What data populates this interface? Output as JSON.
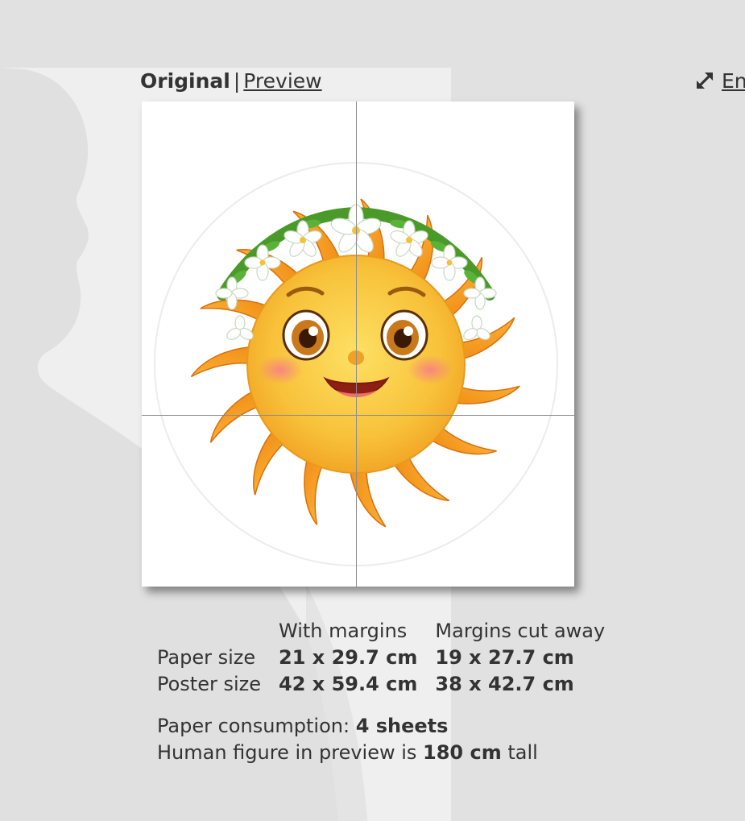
{
  "tabs": {
    "original_label": "Original",
    "separator": "|",
    "preview_label": "Preview"
  },
  "enlarge": {
    "label": "En",
    "icon": "expand-arrows-icon"
  },
  "poster": {
    "image": "smiling sun with flower crown",
    "sheets_horizontal": 2,
    "sheets_vertical": 2
  },
  "table": {
    "col_with_margins": "With margins",
    "col_margins_cut": "Margins cut away",
    "rows": [
      {
        "label": "Paper size",
        "with_margins": "21 x 29.7 cm",
        "cut_away": "19 x 27.7 cm"
      },
      {
        "label": "Poster size",
        "with_margins": "42 x 59.4 cm",
        "cut_away": "38 x 42.7 cm"
      }
    ]
  },
  "summary": {
    "consumption_prefix": "Paper consumption: ",
    "consumption_value": "4 sheets",
    "human_prefix": "Human figure in preview is ",
    "human_value": "180 cm",
    "human_suffix": " tall"
  },
  "colors": {
    "background": "#e1e1e1",
    "panel": "#efefef",
    "text": "#333333",
    "sun_orange": "#f59a1e",
    "sun_face": "#f8c23a"
  }
}
